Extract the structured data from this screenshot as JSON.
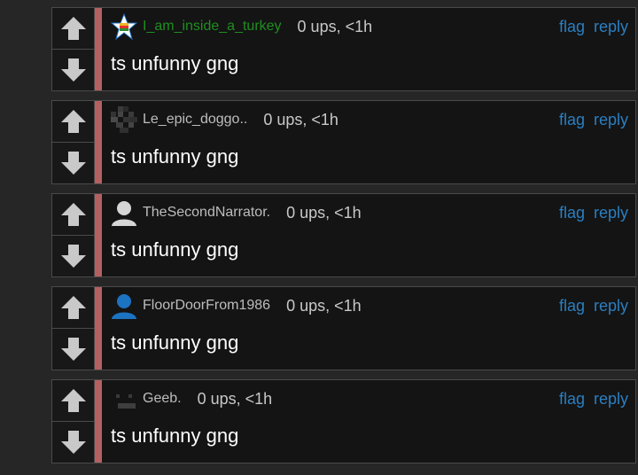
{
  "comments": [
    {
      "username": "I_am_inside_a_turkey",
      "meta": "0 ups, <1h",
      "body": "ts unfunny gng",
      "flag": "flag",
      "reply": "reply",
      "avatar_icon": "star-badge-icon",
      "username_color": "#1f8f1f"
    },
    {
      "username": "Le_epic_doggo..",
      "meta": "0 ups, <1h",
      "body": "ts unfunny gng",
      "flag": "flag",
      "reply": "reply",
      "avatar_icon": "pixel-pattern-icon"
    },
    {
      "username": "TheSecondNarrator.",
      "meta": "0 ups, <1h",
      "body": "ts unfunny gng",
      "flag": "flag",
      "reply": "reply",
      "avatar_icon": "default-user-icon"
    },
    {
      "username": "FloorDoorFrom1986",
      "meta": "0 ups, <1h",
      "body": "ts unfunny gng",
      "flag": "flag",
      "reply": "reply",
      "avatar_icon": "blue-user-icon"
    },
    {
      "username": "Geeb.",
      "meta": "0 ups, <1h",
      "body": "ts unfunny gng",
      "flag": "flag",
      "reply": "reply",
      "avatar_icon": "pixel-face-icon"
    }
  ]
}
